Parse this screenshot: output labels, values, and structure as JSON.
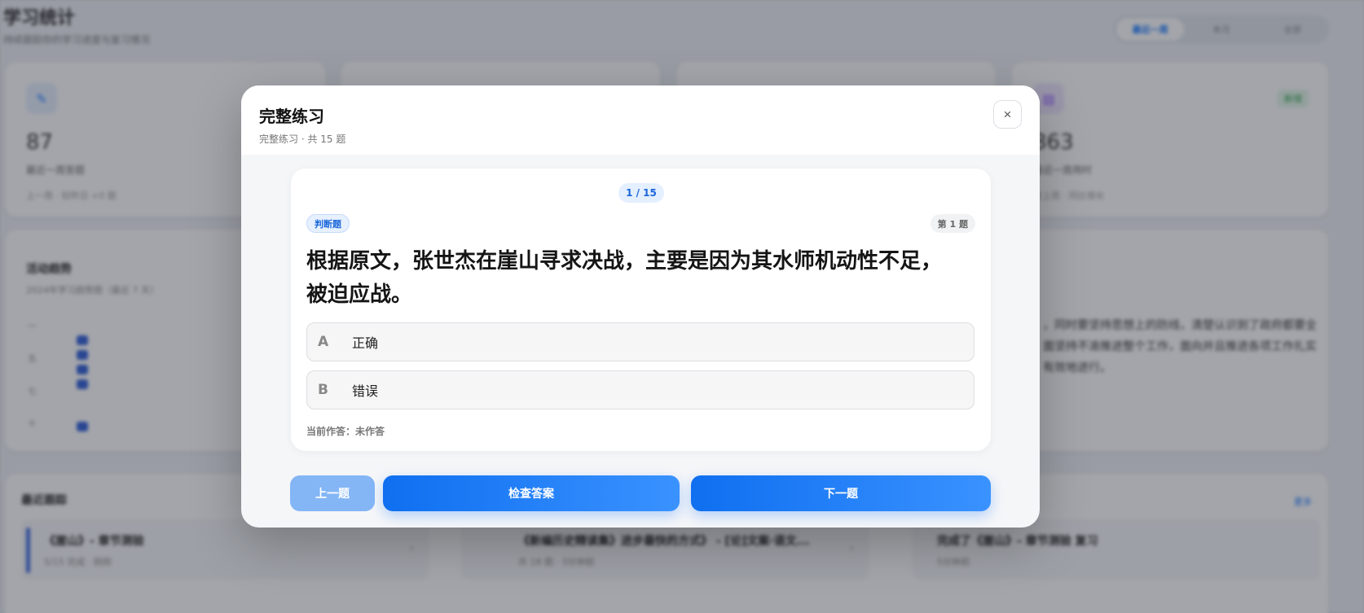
{
  "background": {
    "title": "学习统计",
    "subtitle": "持续跟踪你的学习进度与复习情况",
    "segments": [
      "最近一周",
      "本月",
      "全部"
    ],
    "stat_cards": [
      {
        "icon": "pencil-icon",
        "value": "87",
        "label": "最近一周答题",
        "note": "上一周 · 较昨日 +0 题"
      },
      {
        "icon": "clock-icon",
        "value": "",
        "label": "",
        "note": ""
      },
      {
        "icon": "target-icon",
        "value": "",
        "label": "",
        "note": ""
      },
      {
        "icon": "book-icon",
        "value": "863",
        "label": "最近一周用时",
        "note": "较上周 · 同比增长",
        "tag": "新增"
      }
    ],
    "trend_title": "活动趋势",
    "trend_subtitle": "2024年学习趋势图（最近 7 天）",
    "axis_labels": [
      "一",
      "五",
      "七",
      "十"
    ],
    "reading_text": "，同时要坚持思想上的防线，清楚认识到了政府都要全面坚持不渝推进整个工作，面向并且推进各项工作扎实有效地进行。",
    "recent_title": "最近跟踪",
    "recent_more": "更多",
    "recent_items": [
      {
        "title": "《崖山》- 章节测验",
        "sub": "5/15 完成 · 刚刚"
      },
      {
        "title": "《崖山》- 章节测验",
        "sub": ""
      },
      {
        "title": "《新编历史精读集》进步最快的方式》 - [论]文案·语文...",
        "sub": "共 18 题 · 3分钟前"
      },
      {
        "title": "完成了《崖山》- 章节测验 复习",
        "sub": "5分钟前"
      }
    ]
  },
  "modal": {
    "title": "完整练习",
    "subtitle": "完整练习 · 共 15 题",
    "close_label": "×",
    "progress": "1 / 15",
    "type_badge": "判断题",
    "number_badge": "第 1 题",
    "question": "根据原文，张世杰在崖山寻求决战，主要是因为其水师机动性不足，被迫应战。",
    "options": [
      {
        "letter": "A",
        "text": "正确"
      },
      {
        "letter": "B",
        "text": "错误"
      }
    ],
    "answer_status": "当前作答：未作答",
    "buttons": {
      "prev": "上一题",
      "check": "检查答案",
      "next": "下一题"
    }
  }
}
